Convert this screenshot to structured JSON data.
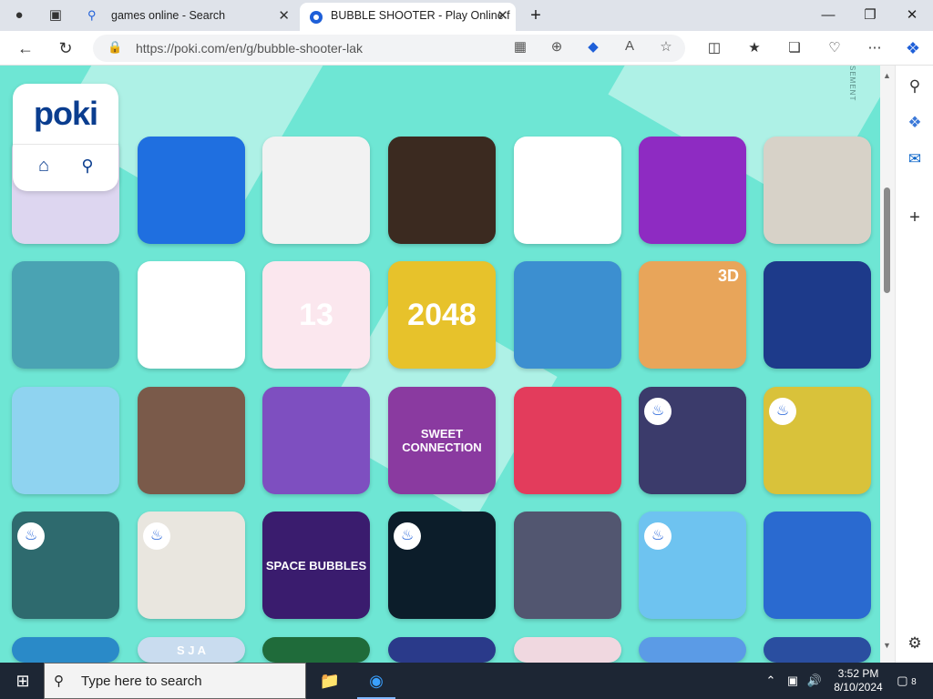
{
  "browser": {
    "tabs": [
      {
        "label": "games online - Search",
        "icon": "search-icon"
      },
      {
        "label": "BUBBLE SHOOTER - Play Online f",
        "icon": "poki-favicon"
      }
    ],
    "url": "https://poki.com/en/g/bubble-shooter-lak"
  },
  "page": {
    "ad_label": "SEMENT",
    "logo": "poki",
    "tiles": [
      {
        "text": "",
        "color": "#ddd6f0",
        "hot": false
      },
      {
        "text": "",
        "color": "#1f6fe0",
        "hot": false
      },
      {
        "text": "",
        "color": "#f2f2f2",
        "hot": false
      },
      {
        "text": "",
        "color": "#3b2a20",
        "hot": false
      },
      {
        "text": "",
        "color": "#ffffff",
        "hot": false
      },
      {
        "text": "",
        "color": "#8e2bc2",
        "hot": false
      },
      {
        "text": "",
        "color": "#d7d2c8",
        "hot": false
      },
      {
        "text": "",
        "color": "#4aa3b3",
        "hot": false
      },
      {
        "text": "",
        "color": "#ffffff",
        "hot": false
      },
      {
        "text": "13",
        "color": "#fbe7ee",
        "hot": false
      },
      {
        "text": "2048",
        "color": "#e7c22b",
        "hot": false
      },
      {
        "text": "",
        "color": "#3c8fd0",
        "hot": false
      },
      {
        "text": "3D",
        "color": "#e8a55a",
        "hot": false
      },
      {
        "text": "",
        "color": "#1d3a8a",
        "hot": false
      },
      {
        "text": "",
        "color": "#8fd3f0",
        "hot": false
      },
      {
        "text": "",
        "color": "#7a5a4a",
        "hot": false
      },
      {
        "text": "",
        "color": "#7e4fc0",
        "hot": false
      },
      {
        "text": "SWEET CONNECTION",
        "color": "#8a3aa0",
        "hot": false
      },
      {
        "text": "",
        "color": "#e33c5c",
        "hot": false
      },
      {
        "text": "",
        "color": "#3b3b6b",
        "hot": true
      },
      {
        "text": "",
        "color": "#d9c23a",
        "hot": true
      },
      {
        "text": "",
        "color": "#2e6a6e",
        "hot": true
      },
      {
        "text": "",
        "color": "#e9e6df",
        "hot": true
      },
      {
        "text": "SPACE BUBBLES",
        "color": "#3a1c6e",
        "hot": false
      },
      {
        "text": "",
        "color": "#0c1d2a",
        "hot": true
      },
      {
        "text": "",
        "color": "#525670",
        "hot": false
      },
      {
        "text": "",
        "color": "#6ec3f0",
        "hot": true
      },
      {
        "text": "",
        "color": "#2a6ad0",
        "hot": false
      },
      {
        "text": "",
        "color": "#2a8ac8",
        "hot": false
      },
      {
        "text": "S J A",
        "color": "#c9dcef",
        "hot": false
      },
      {
        "text": "",
        "color": "#1f6b3a",
        "hot": false
      },
      {
        "text": "",
        "color": "#2a3a8a",
        "hot": false
      },
      {
        "text": "",
        "color": "#f0d8e0",
        "hot": false
      },
      {
        "text": "",
        "color": "#5b9be6",
        "hot": false
      },
      {
        "text": "",
        "color": "#2a4ea0",
        "hot": false
      }
    ]
  },
  "taskbar": {
    "search_placeholder": "Type here to search",
    "time": "3:52 PM",
    "date": "8/10/2024",
    "notification_count": "8"
  }
}
